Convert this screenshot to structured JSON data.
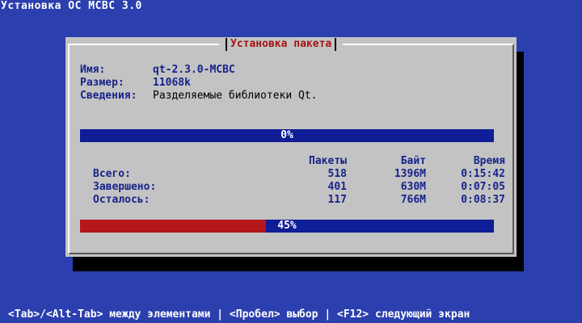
{
  "screen": {
    "title": "Установка ОС МСВС 3.0",
    "help": "<Tab>/<Alt-Tab> между элементами | <Пробел> выбор | <F12> следующий экран"
  },
  "dialog": {
    "title": "Установка пакета",
    "fields": [
      {
        "label": "Имя:",
        "value": "qt-2.3.0-MCBC"
      },
      {
        "label": "Размер:",
        "value": "11068k"
      },
      {
        "label": "Сведения:",
        "value": "Разделяемые библиотеки Qt."
      }
    ],
    "package_progress": {
      "label": "0%",
      "fraction": 0.0
    },
    "stats": {
      "headers": [
        "Пакеты",
        "Байт",
        "Время"
      ],
      "rows": [
        {
          "label": "Всего:",
          "packages": "518",
          "bytes": "1396M",
          "time": "0:15:42"
        },
        {
          "label": "Завершено:",
          "packages": "401",
          "bytes": "630M",
          "time": "0:07:05"
        },
        {
          "label": "Осталось:",
          "packages": "117",
          "bytes": "766M",
          "time": "0:08:37"
        }
      ]
    },
    "total_progress": {
      "label": "45%",
      "fraction": 0.45
    }
  },
  "colors": {
    "background": "#2b3fae",
    "dialog": "#c3c3c3",
    "accent_text": "#17238a",
    "bar_empty": "#0f1d96",
    "bar_fill": "#b5161a",
    "title_text": "#a31515"
  }
}
